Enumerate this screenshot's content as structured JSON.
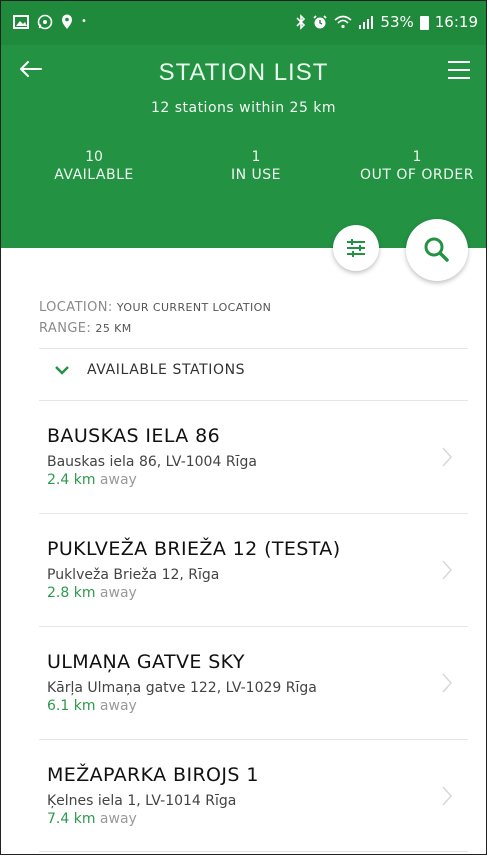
{
  "status_bar": {
    "battery": "53%",
    "time": "16:19",
    "left_icons": [
      "image-icon",
      "whatsapp-icon",
      "location-pin-icon",
      "dot-icon"
    ],
    "right_icons": [
      "bluetooth-icon",
      "alarm-icon",
      "wifi-icon",
      "signal-icon",
      "battery-icon"
    ]
  },
  "header": {
    "title": "STATION LIST",
    "subtitle": "12 stations within 25 km",
    "stats": [
      {
        "value": "10",
        "label": "AVAILABLE"
      },
      {
        "value": "1",
        "label": "IN USE"
      },
      {
        "value": "1",
        "label": "OUT OF ORDER"
      }
    ],
    "color": "#239243"
  },
  "location": {
    "location_key": "LOCATION:",
    "location_value": "YOUR CURRENT LOCATION",
    "range_key": "RANGE:",
    "range_value": "25 KM"
  },
  "section": {
    "label": "AVAILABLE STATIONS"
  },
  "stations": [
    {
      "name": "BAUSKAS IELA 86",
      "address": "Bauskas iela 86, LV-1004 Rīga",
      "distance": "2.4 km",
      "away": "away"
    },
    {
      "name": "PUKLVEŽA BRIEŽA 12 (TESTA)",
      "address": "Puklveža Brieža 12, Rīga",
      "distance": "2.8 km",
      "away": "away"
    },
    {
      "name": "ULMAŅA GATVE SKY",
      "address": "Kārļa Ulmaņa gatve 122, LV-1029 Rīga",
      "distance": "6.1 km",
      "away": "away"
    },
    {
      "name": "MEŽAPARKA BIROJS 1",
      "address": "Ķelnes iela 1, LV-1014 Rīga",
      "distance": "7.4 km",
      "away": "away"
    }
  ]
}
